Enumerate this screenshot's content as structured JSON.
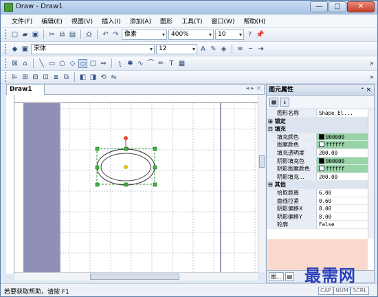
{
  "window": {
    "title": "Draw - Draw1",
    "minimize": "—",
    "maximize": "□",
    "close": "✕"
  },
  "menu": [
    "文件(F)",
    "编辑(E)",
    "视图(V)",
    "插入(I)",
    "添加(A)",
    "图形",
    "工具(T)",
    "窗口(W)",
    "帮助(H)"
  ],
  "toolbar1": {
    "style_value": "像素",
    "zoom_value": "400%",
    "size_value": "10"
  },
  "toolbar2": {
    "font_value": "宋体",
    "fontsize_value": "12"
  },
  "icons": {
    "new": "□",
    "open": "▰",
    "save": "▣",
    "cut": "✂",
    "copy": "⧉",
    "paste": "▤",
    "print": "⎙",
    "undo": "↶",
    "redo": "↷",
    "help": "?",
    "shape": "⬭",
    "text": "A",
    "pen": "✎",
    "fill": "◈",
    "align": "≡",
    "dash": "┄",
    "indent": "⇥",
    "chev": "»"
  },
  "document": {
    "tab_label": "Draw1",
    "nav": "◂ ▸ ×"
  },
  "properties": {
    "title": "图元属性",
    "pin": "ᐩ",
    "close": "×",
    "tool_sort": "▦",
    "tool_az": "↓",
    "rows": [
      {
        "key": "图形名称",
        "value": "Shape_El...",
        "type": "prop"
      },
      {
        "key": "锁定",
        "value": "",
        "type": "cat",
        "exp": "⊞"
      },
      {
        "key": "填充",
        "value": "",
        "type": "cat",
        "exp": "⊟"
      },
      {
        "key": "填充颜色",
        "value": "000000",
        "type": "prop",
        "swatch": "#000000",
        "hl": true
      },
      {
        "key": "图案颜色",
        "value": "ffffff",
        "type": "prop",
        "swatch": "#ffffff",
        "hl": true
      },
      {
        "key": "填充透明度",
        "value": "200.00",
        "type": "prop"
      },
      {
        "key": "阴影填充色",
        "value": "000000",
        "type": "prop",
        "swatch": "#000000",
        "hl": true
      },
      {
        "key": "阴影图案颜色",
        "value": "ffffff",
        "type": "prop",
        "swatch": "#ffffff",
        "hl": true
      },
      {
        "key": "阴影填充...",
        "value": "200.00",
        "type": "prop"
      },
      {
        "key": "其他",
        "value": "",
        "type": "cat",
        "exp": "⊟"
      },
      {
        "key": "拾取距离",
        "value": "6.00",
        "type": "prop"
      },
      {
        "key": "曲线拉紧",
        "value": "0.60",
        "type": "prop"
      },
      {
        "key": "阴影偏移X",
        "value": "8.00",
        "type": "prop"
      },
      {
        "key": "阴影偏移Y",
        "value": "8.00",
        "type": "prop"
      },
      {
        "key": "轮廓",
        "value": "False",
        "type": "prop"
      }
    ],
    "bottom_tab1": "图...",
    "bottom_tab2": "▤"
  },
  "status": {
    "text": "若要获取帮助，请按 F1",
    "cap": "CAP",
    "num": "NUM",
    "scrl": "SCRL"
  },
  "watermark": "最需网",
  "colors": {
    "accent": "#2b3fb8",
    "margin": "#8f8fb8",
    "selection": "#2e9a2e"
  }
}
